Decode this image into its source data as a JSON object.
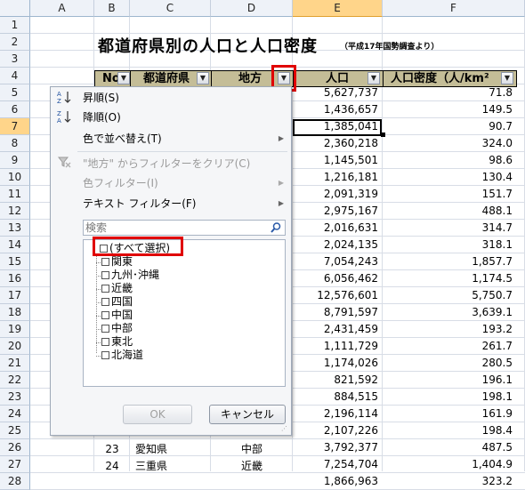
{
  "sheet": {
    "columns": [
      "A",
      "B",
      "C",
      "D",
      "E",
      "F"
    ],
    "selected_column": "E",
    "rows": [
      "1",
      "2",
      "3",
      "4",
      "5",
      "6",
      "7",
      "8",
      "9",
      "10",
      "11",
      "12",
      "13",
      "14",
      "15",
      "16",
      "17",
      "18",
      "19",
      "20",
      "21",
      "22",
      "23",
      "24",
      "25",
      "26",
      "27",
      "28"
    ],
    "selected_row": "7",
    "title": "都道府県別の人口と人口密度",
    "subtitle": "（平成17年国勢調査より）",
    "headers": {
      "no": "No",
      "pref": "都道府県",
      "region": "地方",
      "pop": "人口",
      "density": "人口密度（人/km²"
    },
    "population": [
      "5,627,737",
      "1,436,657",
      "1,385,041",
      "2,360,218",
      "1,145,501",
      "1,216,181",
      "2,091,319",
      "2,975,167",
      "2,016,631",
      "2,024,135",
      "7,054,243",
      "6,056,462",
      "12,576,601",
      "8,791,597",
      "2,431,459",
      "1,111,729",
      "1,174,026",
      "821,592",
      "884,515",
      "2,196,114",
      "2,107,226",
      "3,792,377",
      "7,254,704",
      "1,866,963"
    ],
    "density": [
      "71.8",
      "149.5",
      "90.7",
      "324.0",
      "98.6",
      "130.4",
      "151.7",
      "488.1",
      "314.7",
      "318.1",
      "1,857.7",
      "1,174.5",
      "5,750.7",
      "3,639.1",
      "193.2",
      "261.7",
      "280.5",
      "196.1",
      "198.1",
      "161.9",
      "198.4",
      "487.5",
      "1,404.9",
      "323.2"
    ],
    "visible_rows": [
      {
        "no": "23",
        "pref": "愛知県",
        "region": "中部"
      },
      {
        "no": "24",
        "pref": "三重県",
        "region": "近畿"
      }
    ]
  },
  "filter_menu": {
    "sort_asc": "昇順(S)",
    "sort_desc": "降順(O)",
    "sort_by_color": "色で並べ替え(T)",
    "clear_filter": "\"地方\" からフィルターをクリア(C)",
    "color_filter": "色フィルター(I)",
    "text_filter": "テキスト フィルター(F)",
    "search_placeholder": "検索",
    "select_all": "(すべて選択)",
    "items": [
      "関東",
      "九州･沖縄",
      "近畿",
      "四国",
      "中国",
      "中部",
      "東北",
      "北海道"
    ],
    "ok": "OK",
    "cancel": "キャンセル"
  }
}
